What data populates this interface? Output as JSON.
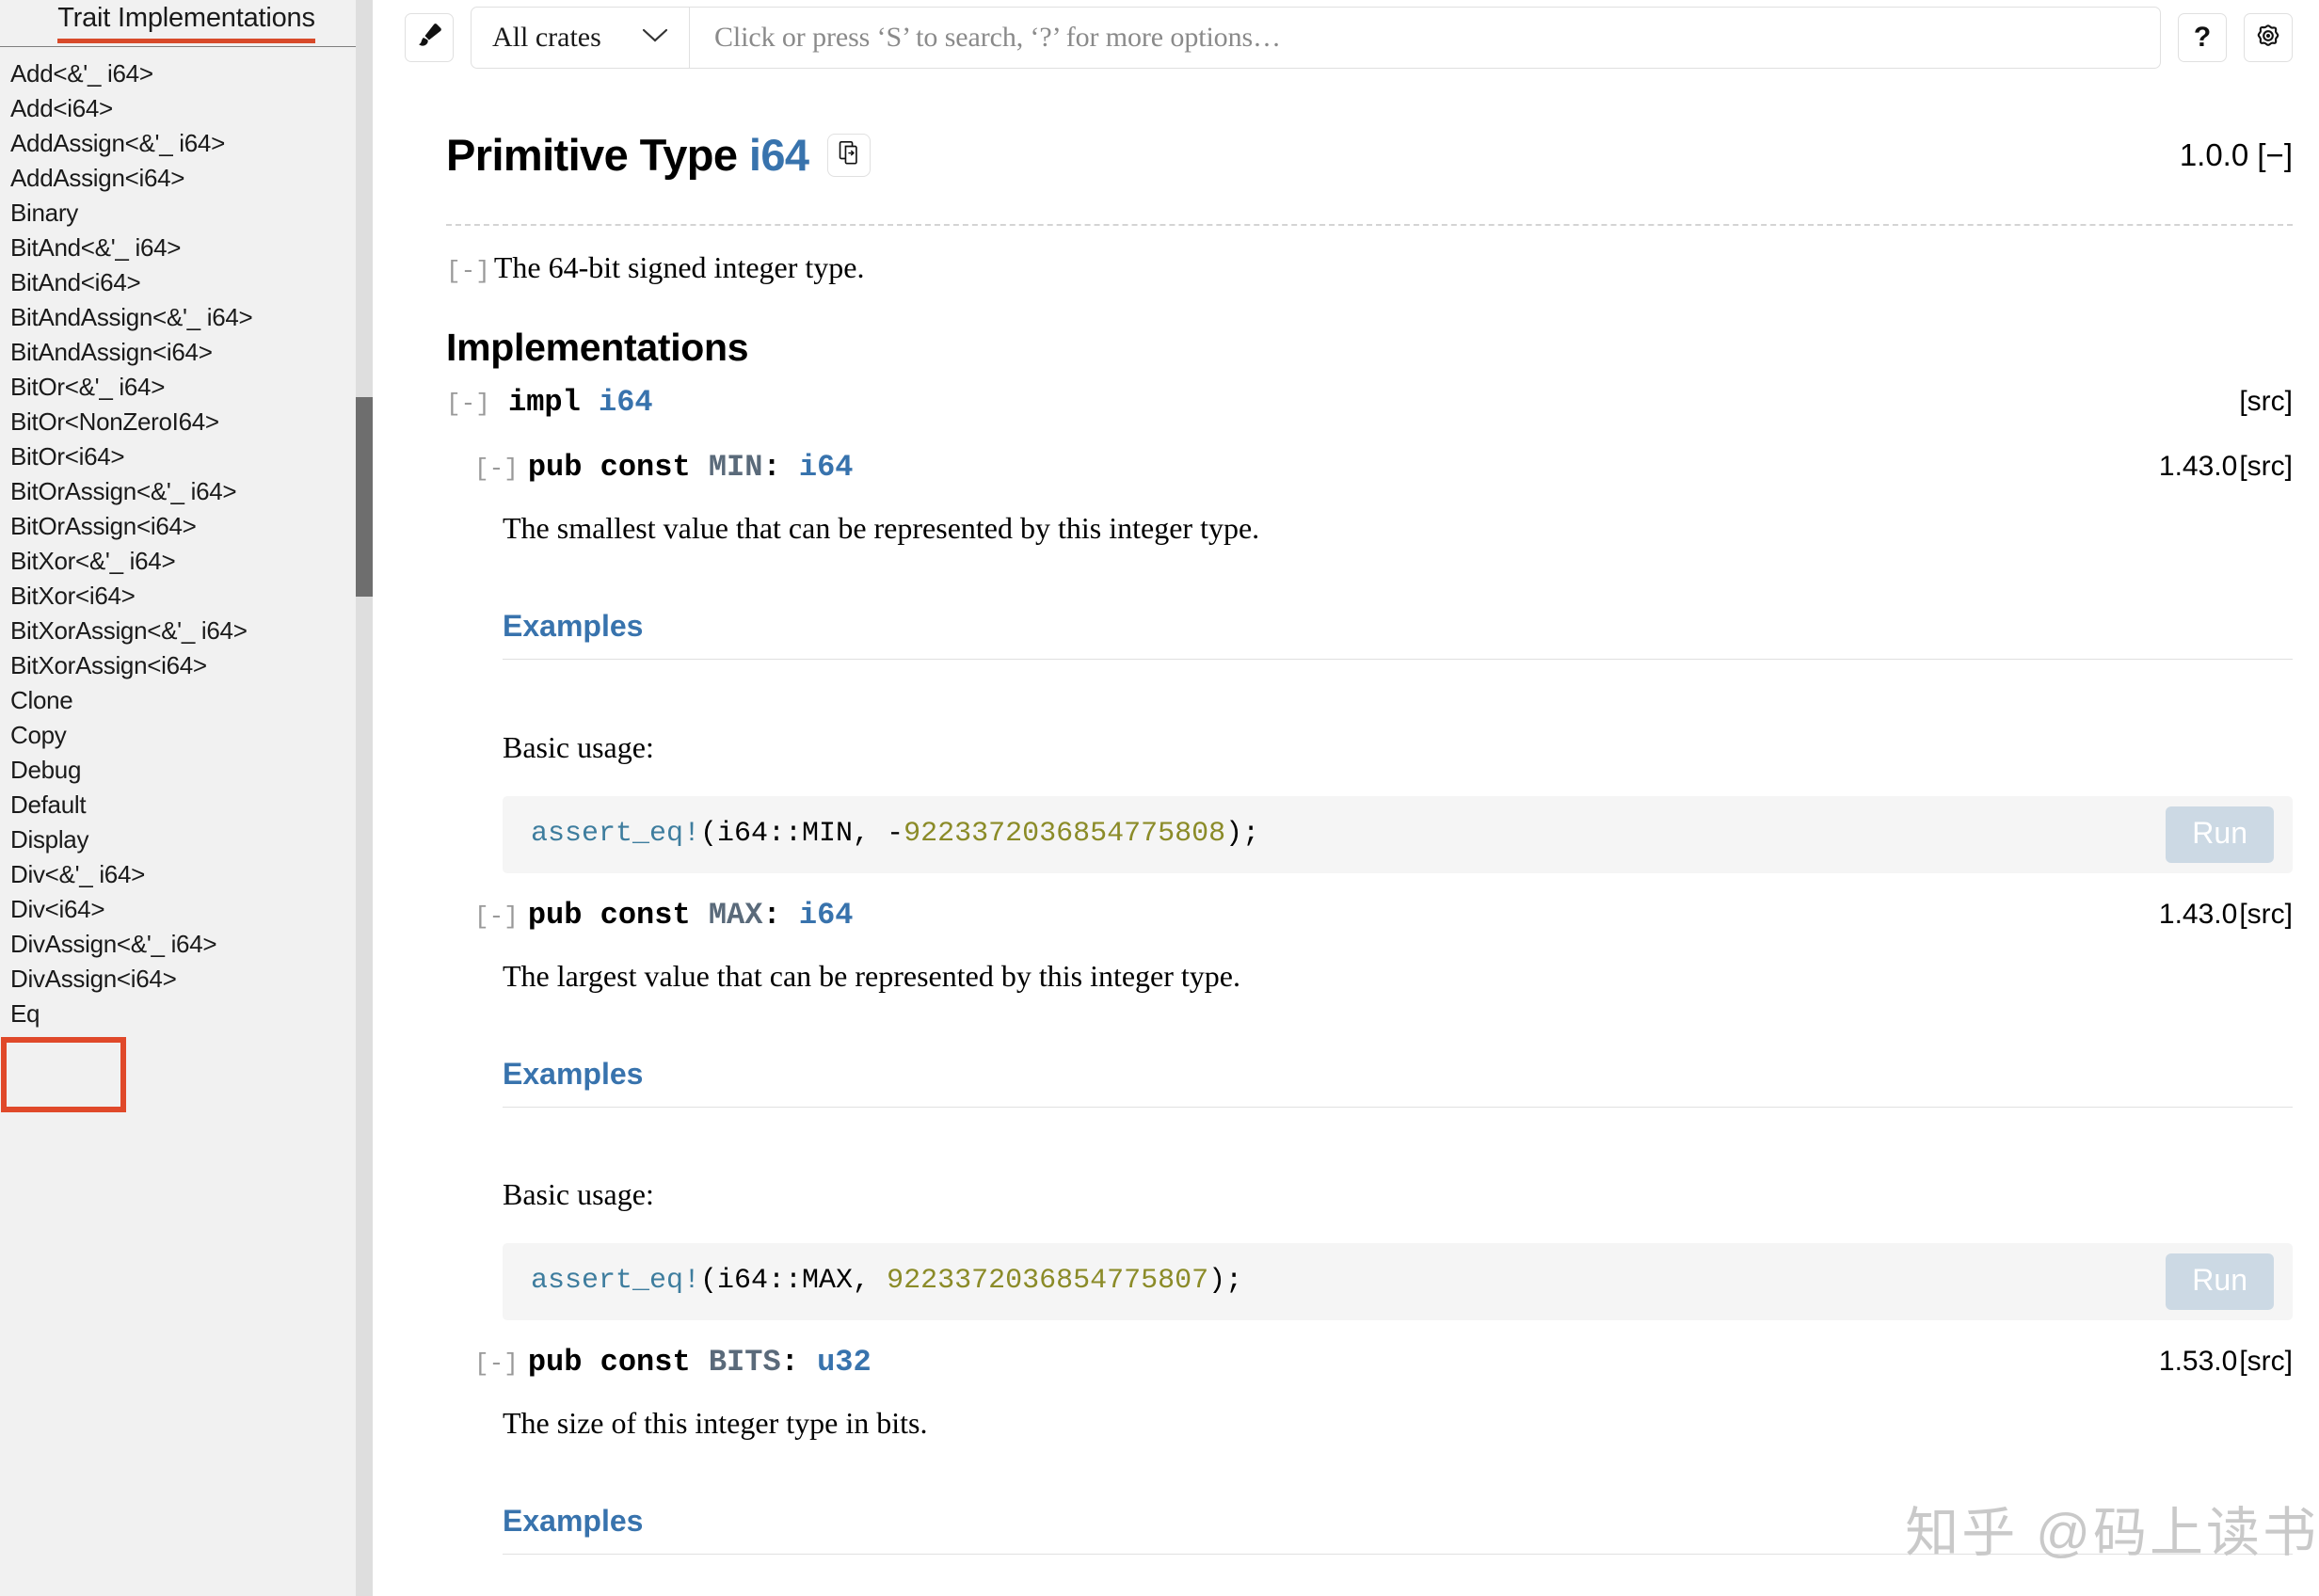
{
  "sidebar": {
    "title": "Trait Implementations",
    "accent_color": "#d84a2a",
    "items": [
      {
        "label": "Add<&'_ i64>"
      },
      {
        "label": "Add<i64>"
      },
      {
        "label": "AddAssign<&'_ i64>"
      },
      {
        "label": "AddAssign<i64>"
      },
      {
        "label": "Binary"
      },
      {
        "label": "BitAnd<&'_ i64>"
      },
      {
        "label": "BitAnd<i64>"
      },
      {
        "label": "BitAndAssign<&'_ i64>"
      },
      {
        "label": "BitAndAssign<i64>"
      },
      {
        "label": "BitOr<&'_ i64>"
      },
      {
        "label": "BitOr<NonZeroI64>"
      },
      {
        "label": "BitOr<i64>"
      },
      {
        "label": "BitOrAssign<&'_ i64>"
      },
      {
        "label": "BitOrAssign<i64>"
      },
      {
        "label": "BitXor<&'_ i64>"
      },
      {
        "label": "BitXor<i64>"
      },
      {
        "label": "BitXorAssign<&'_ i64>"
      },
      {
        "label": "BitXorAssign<i64>"
      },
      {
        "label": "Clone"
      },
      {
        "label": "Copy"
      },
      {
        "label": "Debug"
      },
      {
        "label": "Default"
      },
      {
        "label": "Display"
      },
      {
        "label": "Div<&'_ i64>"
      },
      {
        "label": "Div<i64>"
      },
      {
        "label": "DivAssign<&'_ i64>"
      },
      {
        "label": "DivAssign<i64>"
      },
      {
        "label": "Eq"
      }
    ]
  },
  "toolbar": {
    "theme_icon": "paintbrush-icon",
    "crates_selected": "All crates",
    "chevron_icon": "chevron-down-icon",
    "search_placeholder": "Click or press ‘S’ to search, ‘?’ for more options…",
    "search_value": "",
    "help_label": "?",
    "settings_icon": "gear-icon"
  },
  "main": {
    "title_prefix": "Primitive Type",
    "title_type": "i64",
    "copy_icon": "copy-path-icon",
    "version": "1.0.0",
    "collapse_toggle": "[−]",
    "description_toggle": "[-]",
    "description": "The 64-bit signed integer type.",
    "section_heading": "Implementations",
    "impl": {
      "toggle": "[-]",
      "keyword": "impl",
      "type": "i64",
      "src_label": "[src]"
    },
    "consts": [
      {
        "toggle": "[-]",
        "signature_keyword": "pub const",
        "name": "MIN",
        "type": "i64",
        "since": "1.43.0",
        "src_label": "[src]",
        "doc": "The smallest value that can be represented by this integer type.",
        "examples_heading": "Examples",
        "usage_label": "Basic usage:",
        "code_prefix": "assert_eq!",
        "code_middle": "(i64::MIN, -",
        "code_number": "9223372036854775808",
        "code_suffix": ");",
        "run_label": "Run"
      },
      {
        "toggle": "[-]",
        "signature_keyword": "pub const",
        "name": "MAX",
        "type": "i64",
        "since": "1.43.0",
        "src_label": "[src]",
        "doc": "The largest value that can be represented by this integer type.",
        "examples_heading": "Examples",
        "usage_label": "Basic usage:",
        "code_prefix": "assert_eq!",
        "code_middle": "(i64::MAX, ",
        "code_number": "9223372036854775807",
        "code_suffix": ");",
        "run_label": "Run"
      },
      {
        "toggle": "[-]",
        "signature_keyword": "pub const",
        "name": "BITS",
        "type": "u32",
        "since": "1.53.0",
        "src_label": "[src]",
        "doc": "The size of this integer type in bits.",
        "examples_heading": "Examples"
      }
    ]
  },
  "watermark": "知乎 @码上读书"
}
